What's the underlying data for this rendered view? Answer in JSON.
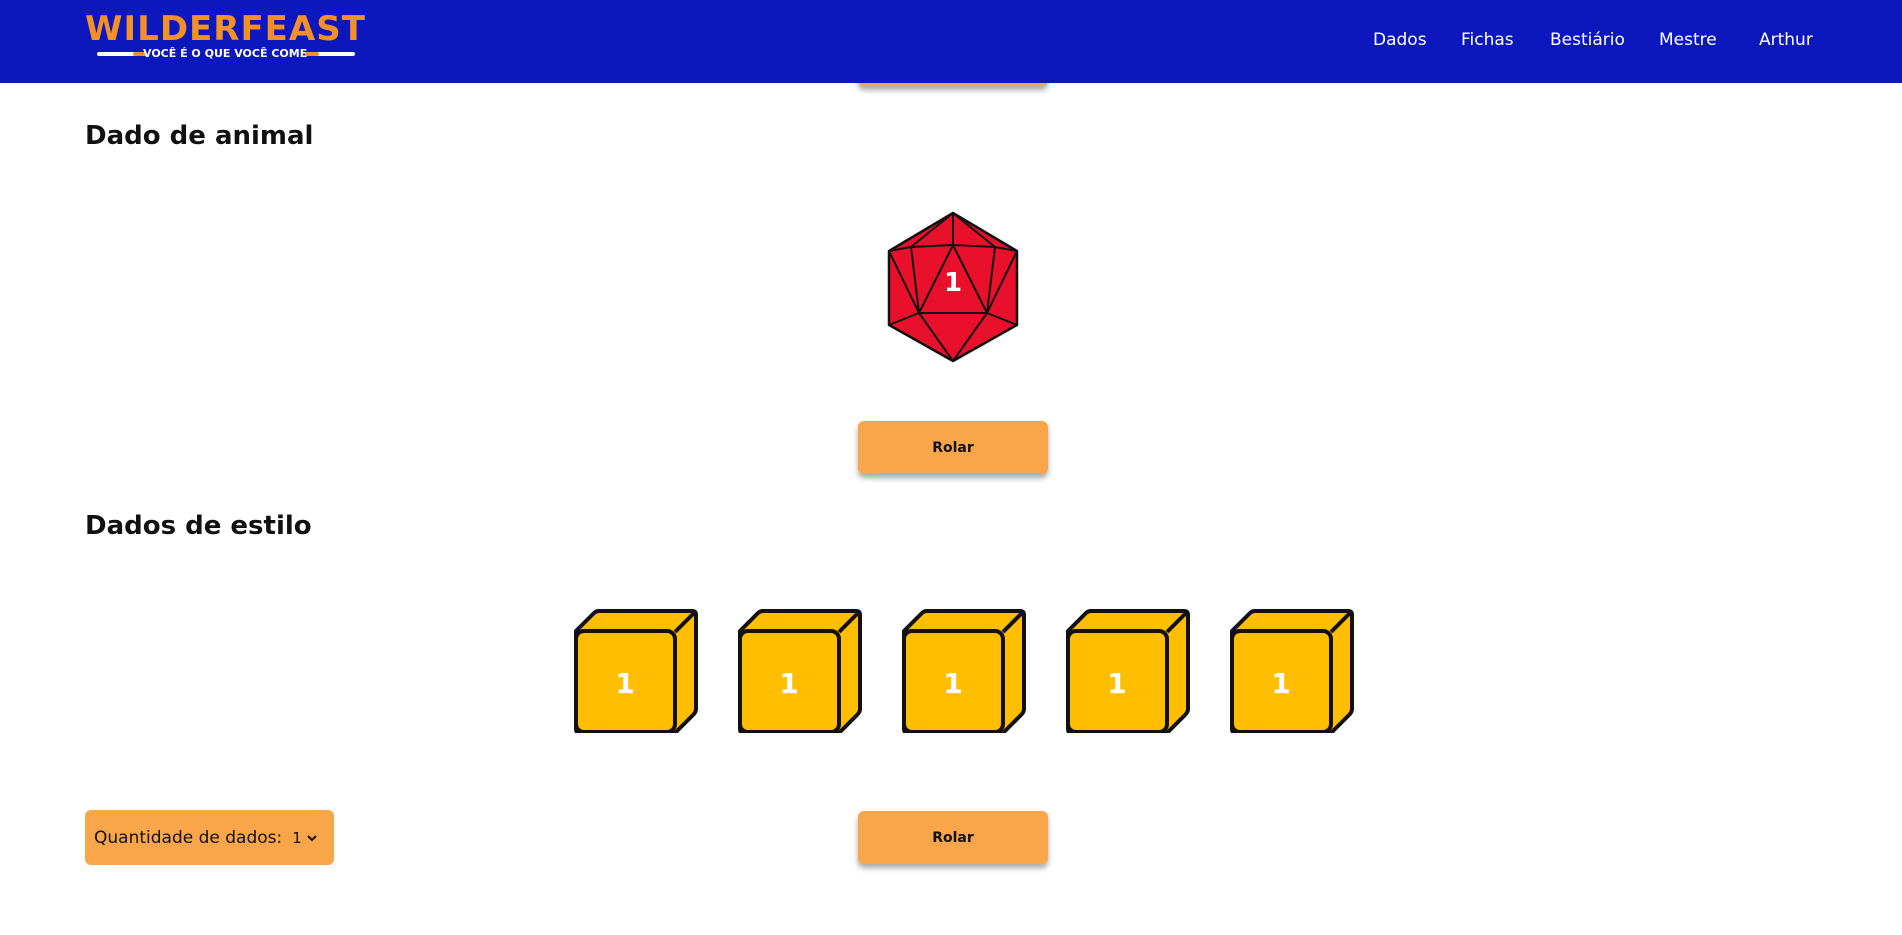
{
  "header": {
    "logo": {
      "title": "WILDERFEAST",
      "subtitle": "VOCÊ É O QUE VOCÊ COME"
    },
    "nav": [
      {
        "label": "Dados"
      },
      {
        "label": "Fichas"
      },
      {
        "label": "Bestiário"
      },
      {
        "label": "Mestre"
      },
      {
        "label": "Arthur"
      }
    ]
  },
  "animal_section": {
    "title": "Dado de animal",
    "die_value": "1",
    "roll_label": "Rolar"
  },
  "style_section": {
    "title": "Dados de estilo",
    "dice": [
      {
        "value": "1"
      },
      {
        "value": "1"
      },
      {
        "value": "1"
      },
      {
        "value": "1"
      },
      {
        "value": "1"
      }
    ],
    "quantity_label": "Quantidade de dados:",
    "quantity_value": "1",
    "roll_label": "Rolar"
  },
  "colors": {
    "header_bg": "#0c18bd",
    "brand_orange": "#f39028",
    "button_bg": "#f9a54a",
    "d20_red": "#e8102a",
    "d6_yellow": "#ffbf00"
  },
  "icons": {
    "d20": "d20-die-icon",
    "d6": "d6-die-icon",
    "select_arrow": "chevron-down-icon"
  }
}
